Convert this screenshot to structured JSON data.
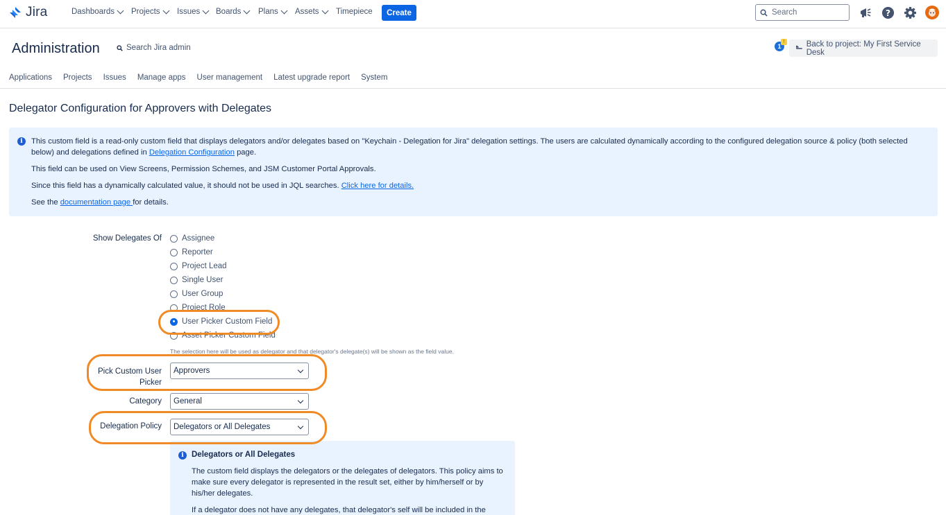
{
  "topnav": {
    "logo": "Jira",
    "items": [
      "Dashboards",
      "Projects",
      "Issues",
      "Boards",
      "Plans",
      "Assets"
    ],
    "timepiece": "Timepiece",
    "create": "Create",
    "search_placeholder": "Search",
    "icons": [
      "megaphone-icon",
      "help-icon",
      "settings-icon",
      "avatar"
    ]
  },
  "admin": {
    "title": "Administration",
    "search": "Search Jira admin",
    "notification_count": "1",
    "back": "Back to project: My First Service Desk",
    "tabs": [
      "Applications",
      "Projects",
      "Issues",
      "Manage apps",
      "User management",
      "Latest upgrade report",
      "System"
    ]
  },
  "page_title": "Delegator Configuration for Approvers with Delegates",
  "info": {
    "line1": "This custom field is a read-only custom field that displays delegators and/or delegates based on \"Keychain - Delegation for Jira\" delegation settings. The users are calculated dynamically according to the configured delegation source & policy (both selected",
    "line2_pre": "below) and delegations defined in ",
    "line2_link": "Delegation Configuration",
    "line2_post": " page.",
    "line3": "This field can be used on View Screens, Permission Schemes, and JSM Customer Portal Approvals.",
    "line4_pre": "Since this field has a dynamically calculated value, it should not be used in JQL searches. ",
    "line4_link": "Click here for details.",
    "line5_pre": "See the ",
    "line5_link": "documentation page ",
    "line5_post": "for details."
  },
  "form": {
    "show_delegates_label": "Show Delegates Of",
    "options": [
      "Assignee",
      "Reporter",
      "Project Lead",
      "Single User",
      "User Group",
      "Project Role",
      "User Picker Custom Field",
      "Asset Picker Custom Field"
    ],
    "selected_option": "User Picker Custom Field",
    "hint": "The selection here will be used as delegator and that delegator's delegate(s) will be shown as the field value.",
    "pick_label_1": "Pick Custom User",
    "pick_label_2": "Picker",
    "pick_value": "Approvers",
    "category_label": "Category",
    "category_value": "General",
    "policy_label": "Delegation Policy",
    "policy_value": "Delegators or All Delegates"
  },
  "policy_info": {
    "title": "Delegators or All Delegates",
    "p1_l1": "The custom field displays the delegators or the delegates of delegators. This policy aims to",
    "p1_l2": "make sure every delegator is represented in the result set, either by him/herself or by",
    "p1_l3": "his/her delegates.",
    "p2_l1": "If a delegator does not have any delegates, that delegator's self will be included in the"
  },
  "colors": {
    "primary": "#0c66e4",
    "info_bg": "#e9f2ff",
    "highlight": "#f08a24"
  }
}
